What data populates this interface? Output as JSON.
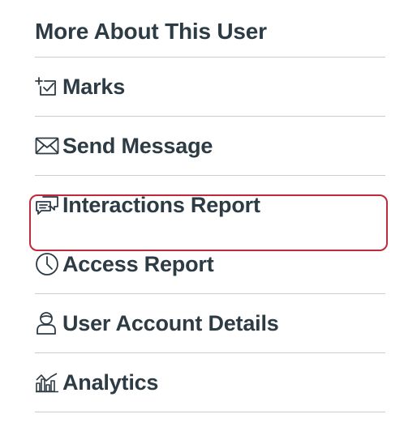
{
  "panel": {
    "title": "More About This User",
    "items": [
      {
        "label": "Marks",
        "icon": "marks-icon"
      },
      {
        "label": "Send Message",
        "icon": "envelope-icon"
      },
      {
        "label": "Interactions Report",
        "icon": "chat-bubbles-icon",
        "highlighted": true
      },
      {
        "label": "Access Report",
        "icon": "clock-icon"
      },
      {
        "label": "User Account Details",
        "icon": "user-icon"
      },
      {
        "label": "Analytics",
        "icon": "analytics-icon"
      }
    ]
  },
  "colors": {
    "text": "#2d3b45",
    "divider": "#c7cdd1",
    "highlight": "#c0283b"
  }
}
